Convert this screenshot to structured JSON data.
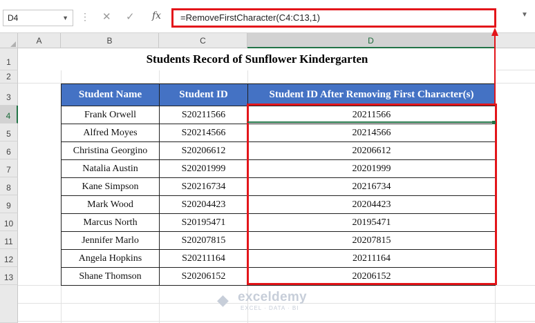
{
  "formula_bar": {
    "name_box": "D4",
    "cancel_icon": "✕",
    "enter_icon": "✓",
    "fx_label": "fx",
    "formula": "=RemoveFirstCharacter(C4:C13,1)"
  },
  "columns": [
    "A",
    "B",
    "C",
    "D"
  ],
  "rows": [
    "1",
    "2",
    "3",
    "4",
    "5",
    "6",
    "7",
    "8",
    "9",
    "10",
    "11",
    "12",
    "13"
  ],
  "title": "Students Record of Sunflower Kindergarten",
  "table": {
    "headers": [
      "Student Name",
      "Student ID",
      "Student ID After Removing First Character(s)"
    ],
    "rows": [
      [
        "Frank Orwell",
        "S20211566",
        "20211566"
      ],
      [
        "Alfred Moyes",
        "S20214566",
        "20214566"
      ],
      [
        "Christina Georgino",
        "S20206612",
        "20206612"
      ],
      [
        "Natalia Austin",
        "S20201999",
        "20201999"
      ],
      [
        "Kane Simpson",
        "S20216734",
        "20216734"
      ],
      [
        "Mark Wood",
        "S20204423",
        "20204423"
      ],
      [
        "Marcus North",
        "S20195471",
        "20195471"
      ],
      [
        "Jennifer Marlo",
        "S20207815",
        "20207815"
      ],
      [
        "Angela Hopkins",
        "S20211164",
        "20211164"
      ],
      [
        "Shane Thomson",
        "S20206152",
        "20206152"
      ]
    ]
  },
  "watermark": {
    "name": "exceldemy",
    "tagline": "EXCEL · DATA · BI"
  },
  "colors": {
    "header_fill": "#4472c4",
    "highlight": "#e3151a",
    "excel_green": "#217346"
  }
}
